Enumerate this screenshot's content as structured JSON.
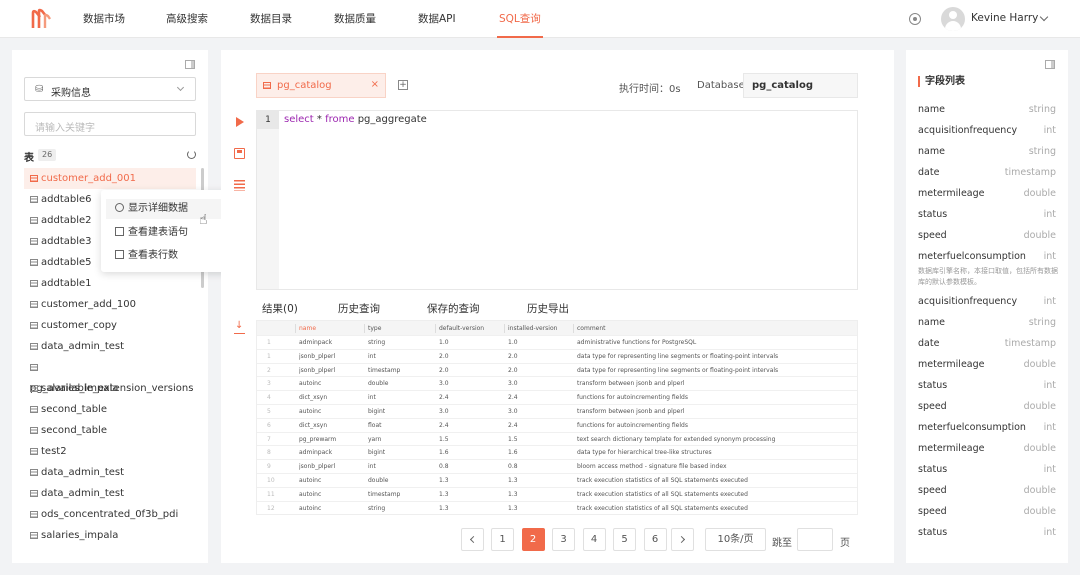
{
  "nav": {
    "items": [
      "数据市场",
      "高级搜索",
      "数据目录",
      "数据质量",
      "数据API",
      "SQL查询"
    ],
    "active_index": 5,
    "user_name": "Kevine Harry"
  },
  "left": {
    "select_value": "采购信息",
    "search_placeholder": "请输入关键字",
    "tables_label": "表",
    "tables_count": "26",
    "tables": [
      "customer_add_001",
      "addtable6",
      "addtable2",
      "addtable3",
      "addtable5",
      "addtable1",
      "customer_add_100",
      "customer_copy",
      "data_admin_test",
      "pg_available_extension_versions",
      "salaries_impala",
      "second_table",
      "second_table",
      "test2",
      "data_admin_test",
      "data_admin_test",
      "ods_concentrated_0f3b_pdi",
      "salaries_impala"
    ],
    "selected_index": 0,
    "context_menu": [
      "显示详细数据",
      "查看建表语句",
      "查看表行数"
    ]
  },
  "center": {
    "tab_label": "pg_catalog",
    "tab_close": "×",
    "add_tab": "+",
    "exec_time": "执行时间：0s",
    "db_label": "Database",
    "db_value": "pg_catalog",
    "line_no": "1",
    "code": {
      "kw1": "select",
      "mid": " * ",
      "kw2": "frome",
      "rest": " pg_aggregate"
    },
    "result_tabs": [
      "结果(0)",
      "历史查询",
      "保存的查询",
      "历史导出"
    ],
    "grid": {
      "headers": [
        "name",
        "type",
        "default-version",
        "installed-version",
        "comment"
      ],
      "rows": [
        [
          "1",
          "adminpack",
          "string",
          "1.0",
          "1.0",
          "administrative functions for PostgreSQL"
        ],
        [
          "1",
          "jsonb_plperl",
          "int",
          "2.0",
          "2.0",
          "data type for representing line segments or floating-point intervals"
        ],
        [
          "2",
          "jsonb_plperl",
          "timestamp",
          "2.0",
          "2.0",
          "data type for representing line segments or floating-point intervals"
        ],
        [
          "3",
          "autoinc",
          "double",
          "3.0",
          "3.0",
          "transform between jsonb and plperl"
        ],
        [
          "4",
          "dict_xsyn",
          "int",
          "2.4",
          "2.4",
          "functions for autoincrementing fields"
        ],
        [
          "5",
          "autoinc",
          "bigint",
          "3.0",
          "3.0",
          "transform between jsonb and plperl"
        ],
        [
          "6",
          "dict_xsyn",
          "float",
          "2.4",
          "2.4",
          "functions for autoincrementing fields"
        ],
        [
          "7",
          "pg_prewarm",
          "yarn",
          "1.5",
          "1.5",
          "text search dictionary template for extended synonym processing"
        ],
        [
          "8",
          "adminpack",
          "bigint",
          "1.6",
          "1.6",
          "data type for hierarchical tree-like structures"
        ],
        [
          "9",
          "jsonb_plperl",
          "int",
          "0.8",
          "0.8",
          "bloom access method - signature file based index"
        ],
        [
          "10",
          "autoinc",
          "double",
          "1.3",
          "1.3",
          "track execution statistics of all SQL statements executed"
        ],
        [
          "11",
          "autoinc",
          "timestamp",
          "1.3",
          "1.3",
          "track execution statistics of all SQL statements executed"
        ],
        [
          "12",
          "autoinc",
          "string",
          "1.3",
          "1.3",
          "track execution statistics of all SQL statements executed"
        ]
      ]
    },
    "pager": {
      "pages": [
        "1",
        "2",
        "3",
        "4",
        "5",
        "6"
      ],
      "current_page": "2",
      "page_size": "10条/页",
      "jump_label": "跳至",
      "page_suffix": "页"
    }
  },
  "right": {
    "title": "字段列表",
    "fields": [
      {
        "name": "name",
        "type": "string"
      },
      {
        "name": "acquisitionfrequency",
        "type": "int"
      },
      {
        "name": "name",
        "type": "string"
      },
      {
        "name": "date",
        "type": "timestamp"
      },
      {
        "name": "metermileage",
        "type": "double"
      },
      {
        "name": "status",
        "type": "int"
      },
      {
        "name": "speed",
        "type": "double"
      },
      {
        "name": "meterfuelconsumption",
        "type": "int"
      },
      {
        "name": "acquisitionfrequency",
        "type": "int"
      },
      {
        "name": "name",
        "type": "string"
      },
      {
        "name": "date",
        "type": "timestamp"
      },
      {
        "name": "metermileage",
        "type": "double"
      },
      {
        "name": "status",
        "type": "int"
      },
      {
        "name": "speed",
        "type": "double"
      },
      {
        "name": "meterfuelconsumption",
        "type": "int"
      },
      {
        "name": "metermileage",
        "type": "double"
      },
      {
        "name": "status",
        "type": "int"
      },
      {
        "name": "speed",
        "type": "double"
      },
      {
        "name": "speed",
        "type": "double"
      },
      {
        "name": "status",
        "type": "int"
      }
    ],
    "field_description": "数据库引擎名称，本接口取值，包括所有数据库的默认参数模板。"
  },
  "colors": {
    "accent": "#f16a4a",
    "accent_light": "#fdeee9"
  }
}
